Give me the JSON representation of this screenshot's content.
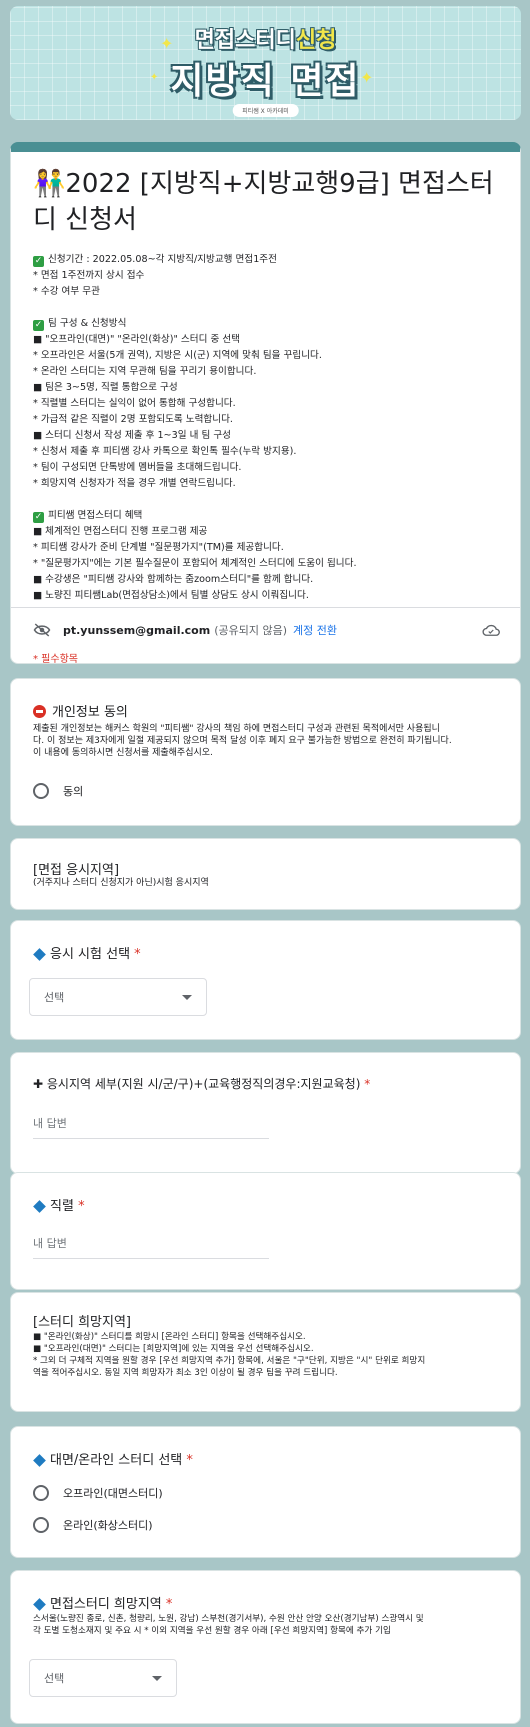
{
  "banner": {
    "line1_a": "면접스터디",
    "line1_b": "신청",
    "line2": "지방직 면접",
    "tag": "피티쌤 X 아카데미"
  },
  "header": {
    "title": "👫2022 [지방직+지방교행9급] 면접스터디 신청서",
    "desc_lines": [
      {
        "check": true,
        "text": "신청기간 : 2022.05.08~각 지방직/지방교행 면접1주전"
      },
      {
        "check": false,
        "text": "* 면접 1주전까지 상시 접수"
      },
      {
        "check": false,
        "text": "* 수강 여부 무관"
      },
      {
        "check": false,
        "text": ""
      },
      {
        "check": true,
        "text": "팀 구성 & 신청방식"
      },
      {
        "check": false,
        "text": "■ \"오프라인(대면)\" \"온라인(화상)\" 스터디 중 선택"
      },
      {
        "check": false,
        "text": "* 오프라인은 서울(5개 권역), 지방은 시(군) 지역에 맞춰 팀을 꾸립니다."
      },
      {
        "check": false,
        "text": "* 온라인 스터디는 지역 무관해 팀을 꾸리기 용이합니다."
      },
      {
        "check": false,
        "text": "■ 팀은 3~5명, 직렬 통합으로 구성"
      },
      {
        "check": false,
        "text": "* 직렬별 스터디는 실익이 없어 통합해 구성합니다."
      },
      {
        "check": false,
        "text": "* 가급적 같은 직렬이 2명 포함되도록 노력합니다."
      },
      {
        "check": false,
        "text": "■ 스터디 신청서 작성 제출 후 1~3일 내 팀 구성"
      },
      {
        "check": false,
        "text": "* 신청서 제출 후 피티쌤 강사 카톡으로 확인톡 필수(누락 방지용)."
      },
      {
        "check": false,
        "text": "* 팀이 구성되면 단톡방에 멤버들을 초대해드립니다."
      },
      {
        "check": false,
        "text": "* 희망지역 신청자가 적을 경우 개별 연락드립니다."
      },
      {
        "check": false,
        "text": ""
      },
      {
        "check": true,
        "text": "피티쌤 면접스터디 혜택"
      },
      {
        "check": false,
        "text": "■ 체계적인 면접스터디 진행 프로그램 제공"
      },
      {
        "check": false,
        "text": "* 피티쌤 강사가 준비 단계별 \"질문평가지\"(TM)를 제공합니다."
      },
      {
        "check": false,
        "text": "* \"질문평가지\"에는 기본 필수질문이 포함되어 체계적인 스터디에 도움이 됩니다."
      },
      {
        "check": false,
        "text": "■ 수강생은 \"피티쌤 강사와 함께하는 줌zoom스터디\"를 함께 합니다."
      },
      {
        "check": false,
        "text": "■ 노량진 피티쌤Lab(면접상담소)에서 팀별 상담도 상시 이뤄집니다."
      }
    ],
    "email": "pt.yunssem@gmail.com",
    "not_shared": "(공유되지 않음)",
    "switch_account": "계정 전환",
    "required_note": "* 필수항목"
  },
  "q_privacy": {
    "title": "개인정보 동의",
    "desc": [
      "제출된 개인정보는 해커스 학원의 \"피티쌤\" 강사의 책임 하에 면접스터디 구성과 관련된 목적에서만 사용됩니",
      "다. 이 정보는 제3자에게 일절 제공되지 않으며 목적 달성 이후 폐지 요구 불가능한 방법으로 완전히 파기됩니다.",
      "이 내용에 동의하시면 신청서를 제출해주십시오."
    ],
    "option": "동의"
  },
  "section_region": {
    "title": "[면접 응시지역]",
    "desc": "(거주지나 스터디 신청지가 아닌)시험 응시지역"
  },
  "q_exam": {
    "title": "응시 시험 선택",
    "required": "*",
    "select": "선택"
  },
  "q_region_detail": {
    "title": "✚ 응시지역 세부(지원 시/군/구)+(교육행정직의경우:지원교육청)",
    "required": "*",
    "placeholder": "내 답변"
  },
  "q_job": {
    "title": "직렬",
    "required": "*",
    "placeholder": "내 답변"
  },
  "section_hope": {
    "title": "[스터디 희망지역]",
    "desc": [
      "■ \"온라인(화상)\" 스터디를 희망시 [온라인 스터디] 항목을 선택해주십시오.",
      "■ \"오프라인(대면)\" 스터디는 [희망지역]에 있는 지역을 우선 선택해주십시오.",
      "* 그외 더 구체적 지역을 원할 경우 [우선 희망지역 추가] 항목에, 서울은 \"구\"단위, 지방은 \"시\" 단위로 희망지",
      "역을 적어주십시오. 동일 지역 희망자가 최소 3인 이상이 될 경우 팀을 꾸려 드립니다."
    ]
  },
  "q_mode": {
    "title": "대면/온라인 스터디 선택",
    "required": "*",
    "options": [
      "오프라인(대면스터디)",
      "온라인(화상스터디)"
    ]
  },
  "q_hope_region": {
    "title": "면접스터디 희망지역",
    "required": "*",
    "desc": [
      "스서울(노량진 종로, 신촌, 청량리, 노원, 강남) 스부천(경기서부), 수원 안산 안양 오산(경기남부) 스광역시 및",
      "각 도별 도청소재지 및 주요 시 * 이외 지역을 우선 원할 경우 아래 [우선 희망지역] 항목에 추가 기입"
    ],
    "select": "선택"
  }
}
